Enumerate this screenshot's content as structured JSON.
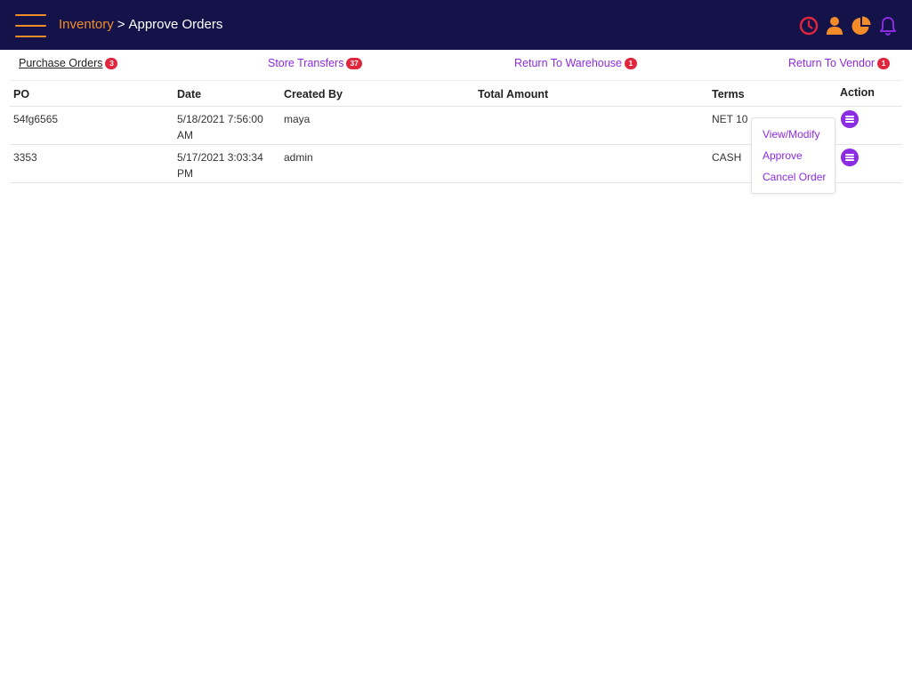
{
  "header": {
    "breadcrumb_root": "Inventory",
    "breadcrumb_separator": ">",
    "breadcrumb_current": "Approve Orders",
    "icons": [
      "clock-icon",
      "user-icon",
      "pie-chart-icon",
      "bell-icon"
    ]
  },
  "tabs": [
    {
      "label": "Purchase Orders",
      "count": "3",
      "active": true
    },
    {
      "label": "Store Transfers",
      "count": "37",
      "active": false
    },
    {
      "label": "Return To Warehouse",
      "count": "1",
      "active": false
    },
    {
      "label": "Return To Vendor",
      "count": "1",
      "active": false
    }
  ],
  "table": {
    "columns": [
      "PO",
      "Date",
      "Created By",
      "Total Amount",
      "Terms",
      "Action"
    ],
    "rows": [
      {
        "po": "54fg6565",
        "date": "5/18/2021 7:56:00 AM",
        "created_by": "maya",
        "total_amount": "",
        "terms": "NET 10"
      },
      {
        "po": "3353",
        "date": "5/17/2021 3:03:34 PM",
        "created_by": "admin",
        "total_amount": "",
        "terms": "CASH"
      }
    ]
  },
  "action_menu": {
    "items": [
      "View/Modify",
      "Approve",
      "Cancel Order"
    ]
  },
  "colors": {
    "header_bg": "#13134a",
    "accent_orange": "#f28c28",
    "accent_purple": "#8b2be2",
    "badge_red": "#e0263c",
    "clock_red": "#e0263c"
  }
}
